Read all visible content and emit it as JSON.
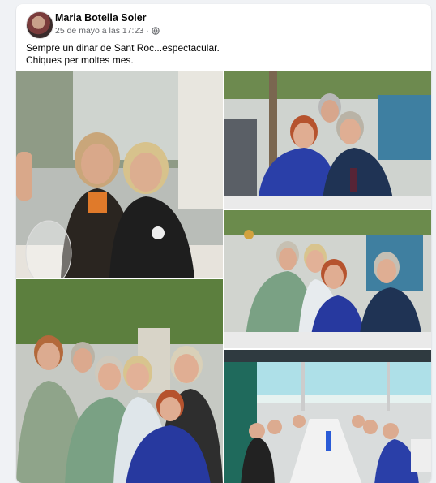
{
  "post": {
    "author": "Maria Botella Soler",
    "timestamp": "25 de mayo a las 17:23 ·",
    "privacy_icon": "globe-icon",
    "text_line1": "Sempre un dinar de Sant Roc...espectacular.",
    "text_line2": "Chiques per moltes mes."
  },
  "photos": [
    {
      "name": "photo-1",
      "icon": "group-photo"
    },
    {
      "name": "photo-2",
      "icon": "group-photo"
    },
    {
      "name": "photo-3",
      "icon": "group-photo"
    },
    {
      "name": "photo-4",
      "icon": "group-photo"
    },
    {
      "name": "photo-5",
      "icon": "group-photo"
    }
  ]
}
